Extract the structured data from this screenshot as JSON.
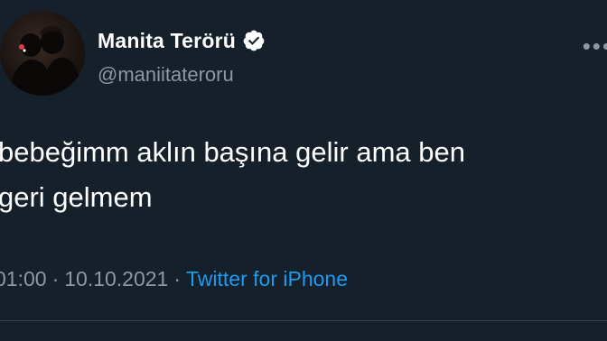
{
  "author": {
    "display_name": "Manita Terörü",
    "handle": "@maniitateroru",
    "verified": true
  },
  "tweet": {
    "text_lines": [
      "bebeğimm aklın başına gelir ama ben",
      "geri gelmem"
    ],
    "time": "01:00",
    "date": "10.10.2021",
    "separator": "·",
    "source": "Twitter for iPhone"
  },
  "icons": {
    "verified": "verified-badge-icon",
    "more": "more-options-icon"
  },
  "colors": {
    "background": "#15202b",
    "text_primary": "#ffffff",
    "text_secondary": "#8b98a5",
    "accent": "#1d9bf0"
  }
}
